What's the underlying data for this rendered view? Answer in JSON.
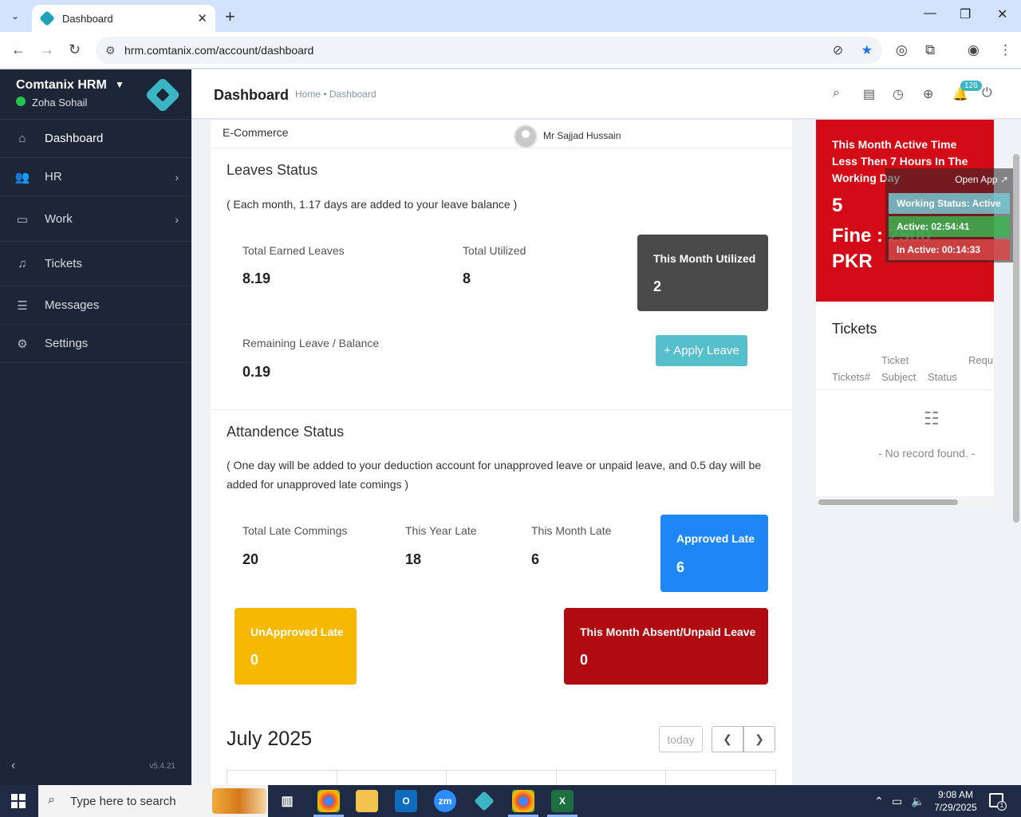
{
  "browser": {
    "tab_title": "Dashboard",
    "url": "hrm.comtanix.com/account/dashboard"
  },
  "sidebar": {
    "brand": "Comtanix HRM",
    "user": "Zoha Sohail",
    "items": [
      {
        "label": "Dashboard",
        "icon": "home-icon"
      },
      {
        "label": "HR",
        "icon": "users-icon"
      },
      {
        "label": "Work",
        "icon": "briefcase-icon"
      },
      {
        "label": "Tickets",
        "icon": "headset-icon"
      },
      {
        "label": "Messages",
        "icon": "message-icon"
      },
      {
        "label": "Settings",
        "icon": "gear-icon"
      }
    ],
    "version": "v5.4.21"
  },
  "header": {
    "title": "Dashboard",
    "breadcrumb": "Home • Dashboard",
    "notification_count": "126"
  },
  "info": {
    "department": "E-Commerce",
    "manager": "Mr Sajjad Hussain"
  },
  "leaves": {
    "title": "Leaves Status",
    "note": "( Each month, 1.17 days are added to your leave balance )",
    "earned_label": "Total Earned Leaves",
    "earned_value": "8.19",
    "utilized_label": "Total Utilized",
    "utilized_value": "8",
    "month_label": "This Month Utilized",
    "month_value": "2",
    "remaining_label": "Remaining Leave / Balance",
    "remaining_value": "0.19",
    "apply_label": "+ Apply Leave"
  },
  "attendance": {
    "title": "Attandence Status",
    "note": "( One day will be added to your deduction account for unapproved leave or unpaid leave, and 0.5 day will be added for unapproved late comings )",
    "total_late_label": "Total Late Commings",
    "total_late_value": "20",
    "year_late_label": "This Year Late",
    "year_late_value": "18",
    "month_late_label": "This Month Late",
    "month_late_value": "6",
    "approved_label": "Approved Late",
    "approved_value": "6",
    "unapproved_label": "UnApproved Late",
    "unapproved_value": "0",
    "absent_label": "This Month Absent/Unpaid Leave",
    "absent_value": "0"
  },
  "calendar": {
    "month": "July 2025",
    "today_label": "today"
  },
  "alert": {
    "message": "This Month Active Time Less Then 7 Hours In The Working Day",
    "count": "5",
    "fine_label": "Fine : ",
    "fine_value": "2500",
    "currency": "PKR"
  },
  "tickets": {
    "title": "Tickets",
    "col1": "Tickets#",
    "col2a": "Ticket",
    "col2b": "Subject",
    "col3": "Status",
    "col4": "Requ",
    "empty": "- No record found. -"
  },
  "widget": {
    "open_app": "Open App ↗",
    "status": "Working Status: Active",
    "active": "Active: 02:54:41",
    "inactive": "In Active: 00:14:33"
  },
  "taskbar": {
    "search_placeholder": "Type here to search",
    "time": "9:08 AM",
    "date": "7/29/2025",
    "notification_count": "1"
  },
  "colors": {
    "sidebar_bg": "#1c2636",
    "accent": "#3bb5c4",
    "approved_blue": "#1f87f5",
    "unapproved_yellow": "#f6b900",
    "absent_red": "#b10b12",
    "alert_red": "#d30b16",
    "dark_box": "#4a4a4a"
  }
}
